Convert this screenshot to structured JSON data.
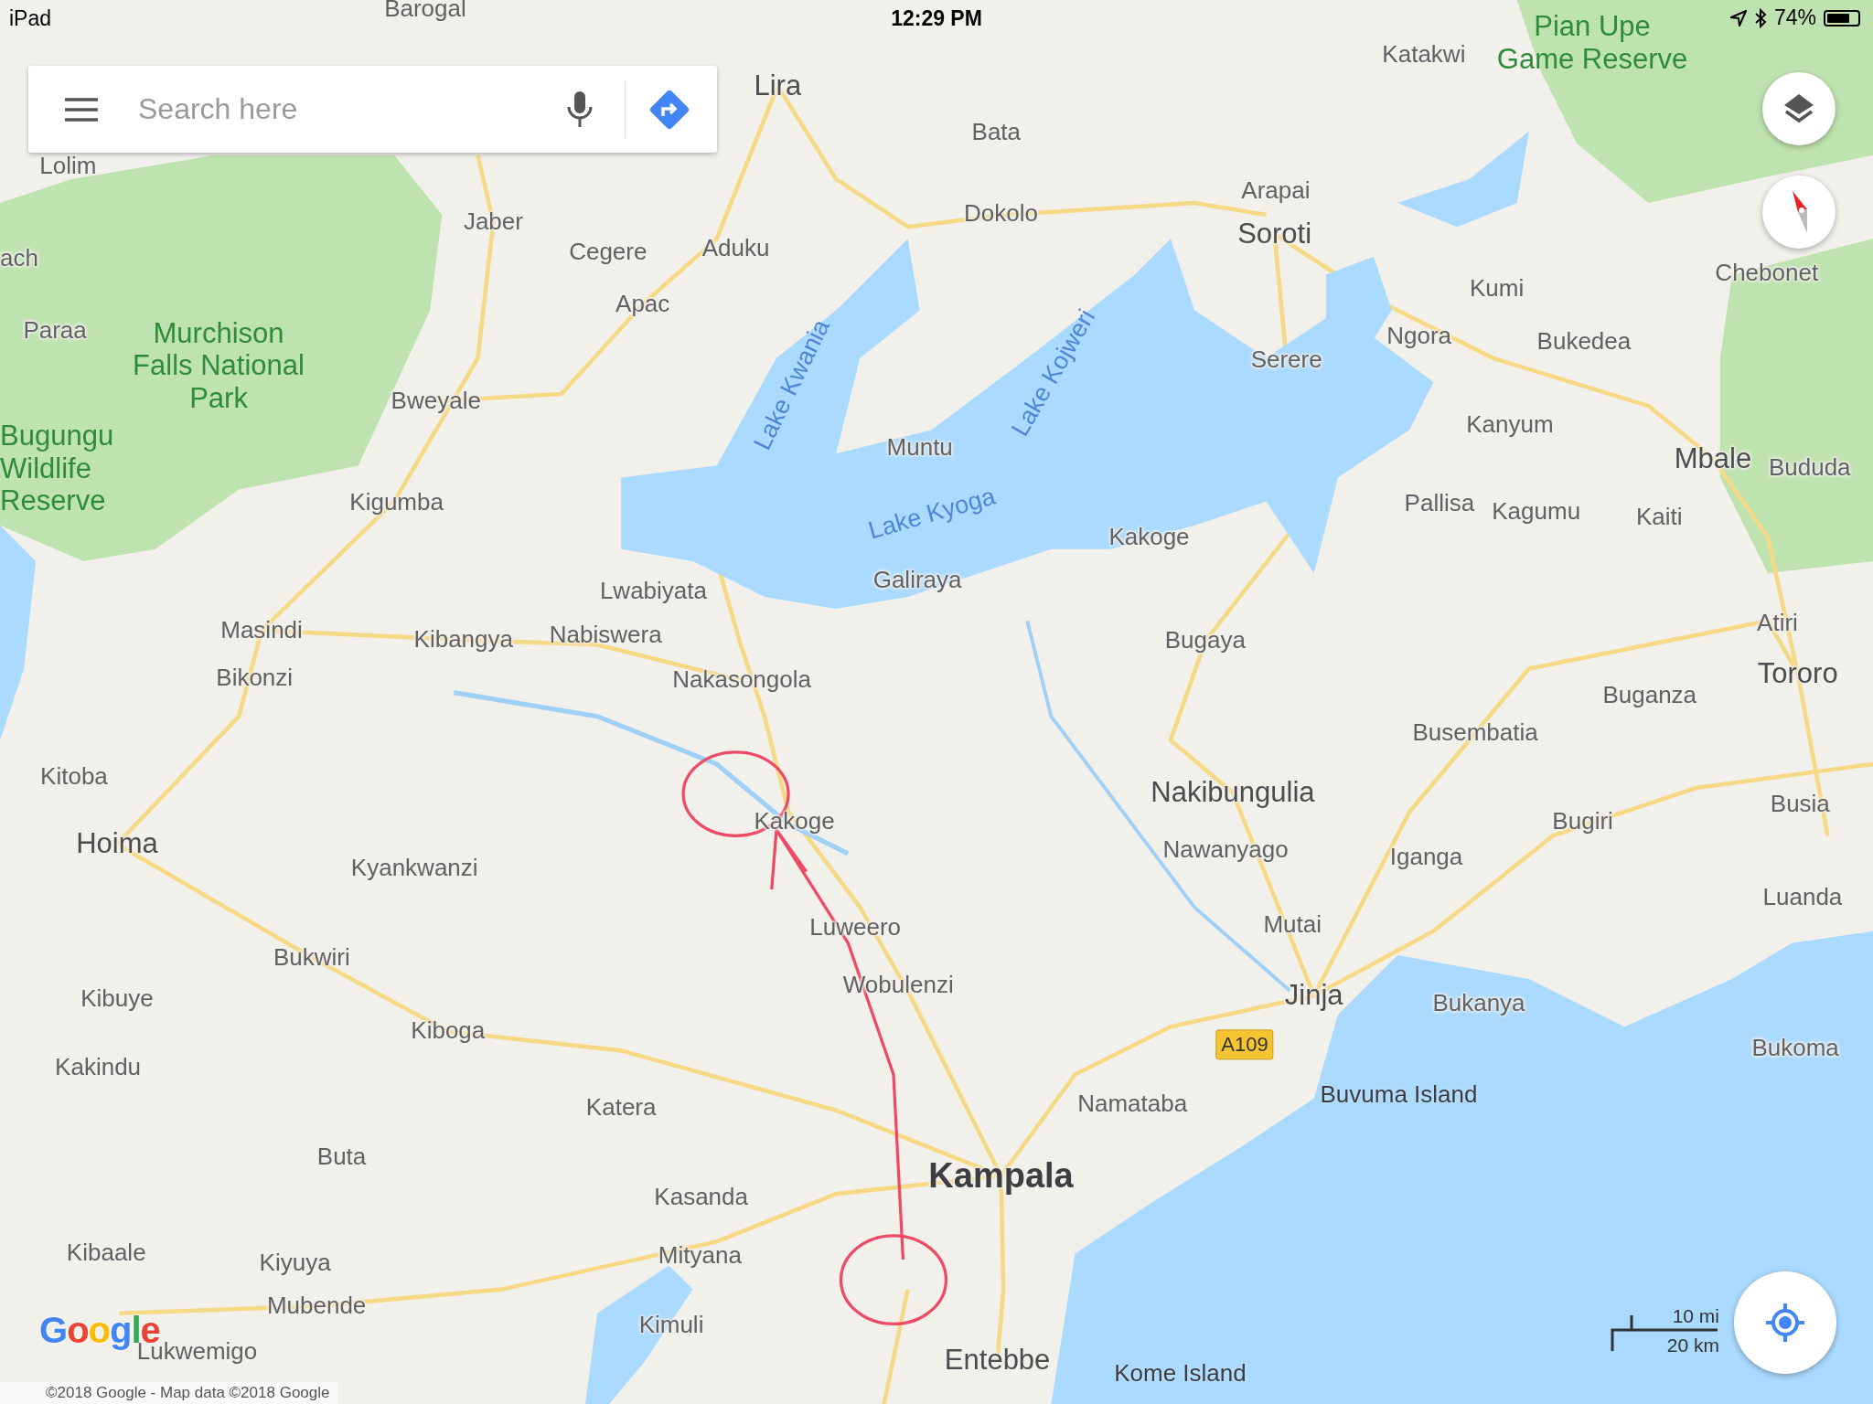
{
  "status_bar": {
    "device": "iPad",
    "time": "12:29 PM",
    "battery": "74%"
  },
  "search_bar": {
    "placeholder": "Search here"
  },
  "map": {
    "labels": [
      {
        "text": "Barogal",
        "kind": "town"
      },
      {
        "text": "Lira",
        "kind": "major"
      },
      {
        "text": "Katakwi",
        "kind": "town"
      },
      {
        "text": "Pian Upe Game Reserve",
        "kind": "park"
      },
      {
        "text": "Lolim",
        "kind": "town"
      },
      {
        "text": "Bata",
        "kind": "town"
      },
      {
        "text": "Jaber",
        "kind": "town"
      },
      {
        "text": "Cegere",
        "kind": "town"
      },
      {
        "text": "Aduku",
        "kind": "town"
      },
      {
        "text": "Dokolo",
        "kind": "town"
      },
      {
        "text": "Arapai",
        "kind": "town"
      },
      {
        "text": "Soroti",
        "kind": "major"
      },
      {
        "text": "Chebonet",
        "kind": "town"
      },
      {
        "text": "ach",
        "kind": "town"
      },
      {
        "text": "Kumi",
        "kind": "town"
      },
      {
        "text": "Apac",
        "kind": "town"
      },
      {
        "text": "Paraa",
        "kind": "town"
      },
      {
        "text": "Murchison Falls National Park",
        "kind": "park"
      },
      {
        "text": "Lake Kwania",
        "kind": "lake"
      },
      {
        "text": "Lake Kojweri",
        "kind": "lake"
      },
      {
        "text": "Ngora",
        "kind": "town"
      },
      {
        "text": "Bukedea",
        "kind": "town"
      },
      {
        "text": "Serere",
        "kind": "town"
      },
      {
        "text": "Bweyale",
        "kind": "town"
      },
      {
        "text": "Bugungu Wildlife Reserve",
        "kind": "park"
      },
      {
        "text": "Muntu",
        "kind": "town"
      },
      {
        "text": "Kanyum",
        "kind": "town"
      },
      {
        "text": "Mbale",
        "kind": "major"
      },
      {
        "text": "Bududa",
        "kind": "town"
      },
      {
        "text": "Lake Kyoga",
        "kind": "lake"
      },
      {
        "text": "Kigumba",
        "kind": "town"
      },
      {
        "text": "Pallisa",
        "kind": "town"
      },
      {
        "text": "Kagumu",
        "kind": "town"
      },
      {
        "text": "Kaiti",
        "kind": "town"
      },
      {
        "text": "Kakoge",
        "kind": "town"
      },
      {
        "text": "Galiraya",
        "kind": "town"
      },
      {
        "text": "Lwabiyata",
        "kind": "town"
      },
      {
        "text": "Masindi",
        "kind": "town"
      },
      {
        "text": "Kibangya",
        "kind": "town"
      },
      {
        "text": "Nabiswera",
        "kind": "town"
      },
      {
        "text": "Bugaya",
        "kind": "town"
      },
      {
        "text": "Atiri",
        "kind": "town"
      },
      {
        "text": "Bikonzi",
        "kind": "town"
      },
      {
        "text": "Nakasongola",
        "kind": "town"
      },
      {
        "text": "Buganza",
        "kind": "town"
      },
      {
        "text": "Tororo",
        "kind": "major"
      },
      {
        "text": "Busembatia",
        "kind": "town"
      },
      {
        "text": "Kitoba",
        "kind": "town"
      },
      {
        "text": "Nakibungulia",
        "kind": "major"
      },
      {
        "text": "Kakoge",
        "kind": "town"
      },
      {
        "text": "Busia",
        "kind": "town"
      },
      {
        "text": "Bugiri",
        "kind": "town"
      },
      {
        "text": "Hoima",
        "kind": "major"
      },
      {
        "text": "Kyankwanzi",
        "kind": "town"
      },
      {
        "text": "Nawanyago",
        "kind": "town"
      },
      {
        "text": "Iganga",
        "kind": "town"
      },
      {
        "text": "Luanda",
        "kind": "town"
      },
      {
        "text": "Luweero",
        "kind": "town"
      },
      {
        "text": "Mutai",
        "kind": "town"
      },
      {
        "text": "Bukwiri",
        "kind": "town"
      },
      {
        "text": "Kibuye",
        "kind": "town"
      },
      {
        "text": "Wobulenzi",
        "kind": "town"
      },
      {
        "text": "Jinja",
        "kind": "major"
      },
      {
        "text": "Bukanya",
        "kind": "town"
      },
      {
        "text": "Kiboga",
        "kind": "town"
      },
      {
        "text": "A109",
        "kind": "shield"
      },
      {
        "text": "Bukoma",
        "kind": "town"
      },
      {
        "text": "Kakindu",
        "kind": "town"
      },
      {
        "text": "Buvuma Island",
        "kind": "island"
      },
      {
        "text": "Katera",
        "kind": "town"
      },
      {
        "text": "Namataba",
        "kind": "town"
      },
      {
        "text": "Buta",
        "kind": "town"
      },
      {
        "text": "Kampala",
        "kind": "capital"
      },
      {
        "text": "Kasanda",
        "kind": "town"
      },
      {
        "text": "Kibaale",
        "kind": "town"
      },
      {
        "text": "Kiyuya",
        "kind": "town"
      },
      {
        "text": "Mityana",
        "kind": "town"
      },
      {
        "text": "Mubende",
        "kind": "town"
      },
      {
        "text": "Kimuli",
        "kind": "town"
      },
      {
        "text": "Lukwemigo",
        "kind": "town"
      },
      {
        "text": "Entebbe",
        "kind": "major"
      },
      {
        "text": "Kome Island",
        "kind": "island"
      }
    ]
  },
  "logo": "Google",
  "copyright": "©2018 Google - Map data ©2018 Google",
  "scale": {
    "imperial": "10 mi",
    "metric": "20 km"
  }
}
